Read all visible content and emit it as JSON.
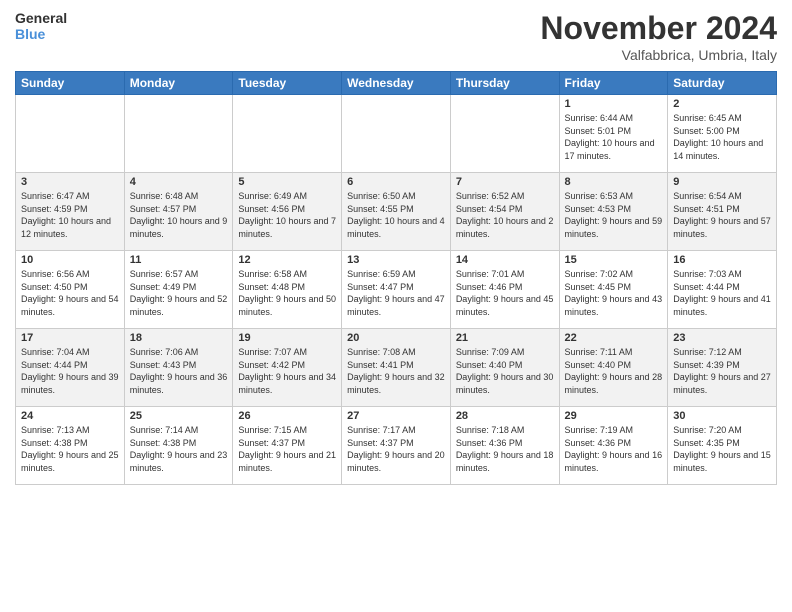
{
  "logo": {
    "line1": "General",
    "line2": "Blue"
  },
  "title": "November 2024",
  "subtitle": "Valfabbrica, Umbria, Italy",
  "days_header": [
    "Sunday",
    "Monday",
    "Tuesday",
    "Wednesday",
    "Thursday",
    "Friday",
    "Saturday"
  ],
  "weeks": [
    [
      {
        "day": "",
        "info": ""
      },
      {
        "day": "",
        "info": ""
      },
      {
        "day": "",
        "info": ""
      },
      {
        "day": "",
        "info": ""
      },
      {
        "day": "",
        "info": ""
      },
      {
        "day": "1",
        "info": "Sunrise: 6:44 AM\nSunset: 5:01 PM\nDaylight: 10 hours and 17 minutes."
      },
      {
        "day": "2",
        "info": "Sunrise: 6:45 AM\nSunset: 5:00 PM\nDaylight: 10 hours and 14 minutes."
      }
    ],
    [
      {
        "day": "3",
        "info": "Sunrise: 6:47 AM\nSunset: 4:59 PM\nDaylight: 10 hours and 12 minutes."
      },
      {
        "day": "4",
        "info": "Sunrise: 6:48 AM\nSunset: 4:57 PM\nDaylight: 10 hours and 9 minutes."
      },
      {
        "day": "5",
        "info": "Sunrise: 6:49 AM\nSunset: 4:56 PM\nDaylight: 10 hours and 7 minutes."
      },
      {
        "day": "6",
        "info": "Sunrise: 6:50 AM\nSunset: 4:55 PM\nDaylight: 10 hours and 4 minutes."
      },
      {
        "day": "7",
        "info": "Sunrise: 6:52 AM\nSunset: 4:54 PM\nDaylight: 10 hours and 2 minutes."
      },
      {
        "day": "8",
        "info": "Sunrise: 6:53 AM\nSunset: 4:53 PM\nDaylight: 9 hours and 59 minutes."
      },
      {
        "day": "9",
        "info": "Sunrise: 6:54 AM\nSunset: 4:51 PM\nDaylight: 9 hours and 57 minutes."
      }
    ],
    [
      {
        "day": "10",
        "info": "Sunrise: 6:56 AM\nSunset: 4:50 PM\nDaylight: 9 hours and 54 minutes."
      },
      {
        "day": "11",
        "info": "Sunrise: 6:57 AM\nSunset: 4:49 PM\nDaylight: 9 hours and 52 minutes."
      },
      {
        "day": "12",
        "info": "Sunrise: 6:58 AM\nSunset: 4:48 PM\nDaylight: 9 hours and 50 minutes."
      },
      {
        "day": "13",
        "info": "Sunrise: 6:59 AM\nSunset: 4:47 PM\nDaylight: 9 hours and 47 minutes."
      },
      {
        "day": "14",
        "info": "Sunrise: 7:01 AM\nSunset: 4:46 PM\nDaylight: 9 hours and 45 minutes."
      },
      {
        "day": "15",
        "info": "Sunrise: 7:02 AM\nSunset: 4:45 PM\nDaylight: 9 hours and 43 minutes."
      },
      {
        "day": "16",
        "info": "Sunrise: 7:03 AM\nSunset: 4:44 PM\nDaylight: 9 hours and 41 minutes."
      }
    ],
    [
      {
        "day": "17",
        "info": "Sunrise: 7:04 AM\nSunset: 4:44 PM\nDaylight: 9 hours and 39 minutes."
      },
      {
        "day": "18",
        "info": "Sunrise: 7:06 AM\nSunset: 4:43 PM\nDaylight: 9 hours and 36 minutes."
      },
      {
        "day": "19",
        "info": "Sunrise: 7:07 AM\nSunset: 4:42 PM\nDaylight: 9 hours and 34 minutes."
      },
      {
        "day": "20",
        "info": "Sunrise: 7:08 AM\nSunset: 4:41 PM\nDaylight: 9 hours and 32 minutes."
      },
      {
        "day": "21",
        "info": "Sunrise: 7:09 AM\nSunset: 4:40 PM\nDaylight: 9 hours and 30 minutes."
      },
      {
        "day": "22",
        "info": "Sunrise: 7:11 AM\nSunset: 4:40 PM\nDaylight: 9 hours and 28 minutes."
      },
      {
        "day": "23",
        "info": "Sunrise: 7:12 AM\nSunset: 4:39 PM\nDaylight: 9 hours and 27 minutes."
      }
    ],
    [
      {
        "day": "24",
        "info": "Sunrise: 7:13 AM\nSunset: 4:38 PM\nDaylight: 9 hours and 25 minutes."
      },
      {
        "day": "25",
        "info": "Sunrise: 7:14 AM\nSunset: 4:38 PM\nDaylight: 9 hours and 23 minutes."
      },
      {
        "day": "26",
        "info": "Sunrise: 7:15 AM\nSunset: 4:37 PM\nDaylight: 9 hours and 21 minutes."
      },
      {
        "day": "27",
        "info": "Sunrise: 7:17 AM\nSunset: 4:37 PM\nDaylight: 9 hours and 20 minutes."
      },
      {
        "day": "28",
        "info": "Sunrise: 7:18 AM\nSunset: 4:36 PM\nDaylight: 9 hours and 18 minutes."
      },
      {
        "day": "29",
        "info": "Sunrise: 7:19 AM\nSunset: 4:36 PM\nDaylight: 9 hours and 16 minutes."
      },
      {
        "day": "30",
        "info": "Sunrise: 7:20 AM\nSunset: 4:35 PM\nDaylight: 9 hours and 15 minutes."
      }
    ]
  ]
}
